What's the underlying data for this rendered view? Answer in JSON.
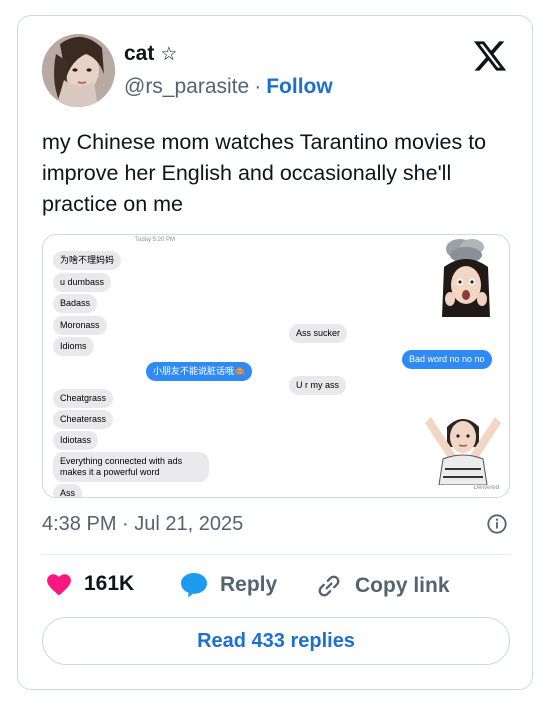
{
  "author": {
    "name": "cat",
    "badge_icon": "star-icon",
    "handle": "@rs_parasite",
    "separator": "·",
    "follow_label": "Follow"
  },
  "tweet": {
    "text": "my Chinese mom watches Tarantino movies to improve her English and occasionally she'll practice on me"
  },
  "media": {
    "time_label": "Today 5:20 PM",
    "bubbles": [
      "为啥不理妈妈",
      "u dumbass",
      "Badass",
      "Moronass",
      "Idioms",
      "Ass sucker",
      "Bad word no no no",
      "小朋友不能说脏话哦🙈",
      "U r my ass",
      "Cheatgrass",
      "Cheaterass",
      "Idiotass",
      "Everything connected with ads makes it a powerful word",
      "Ass"
    ],
    "delivered_label": "Delivered"
  },
  "meta": {
    "timestamp": "4:38 PM · Jul 21, 2025"
  },
  "actions": {
    "likes": "161K",
    "reply_label": "Reply",
    "copy_link_label": "Copy link"
  },
  "read_replies_label": "Read 433 replies",
  "colors": {
    "accent": "#1d6fd0",
    "heart": "#f91880",
    "reply_bubble": "#1d9bf0",
    "imessage_blue": "#2f8af5"
  }
}
